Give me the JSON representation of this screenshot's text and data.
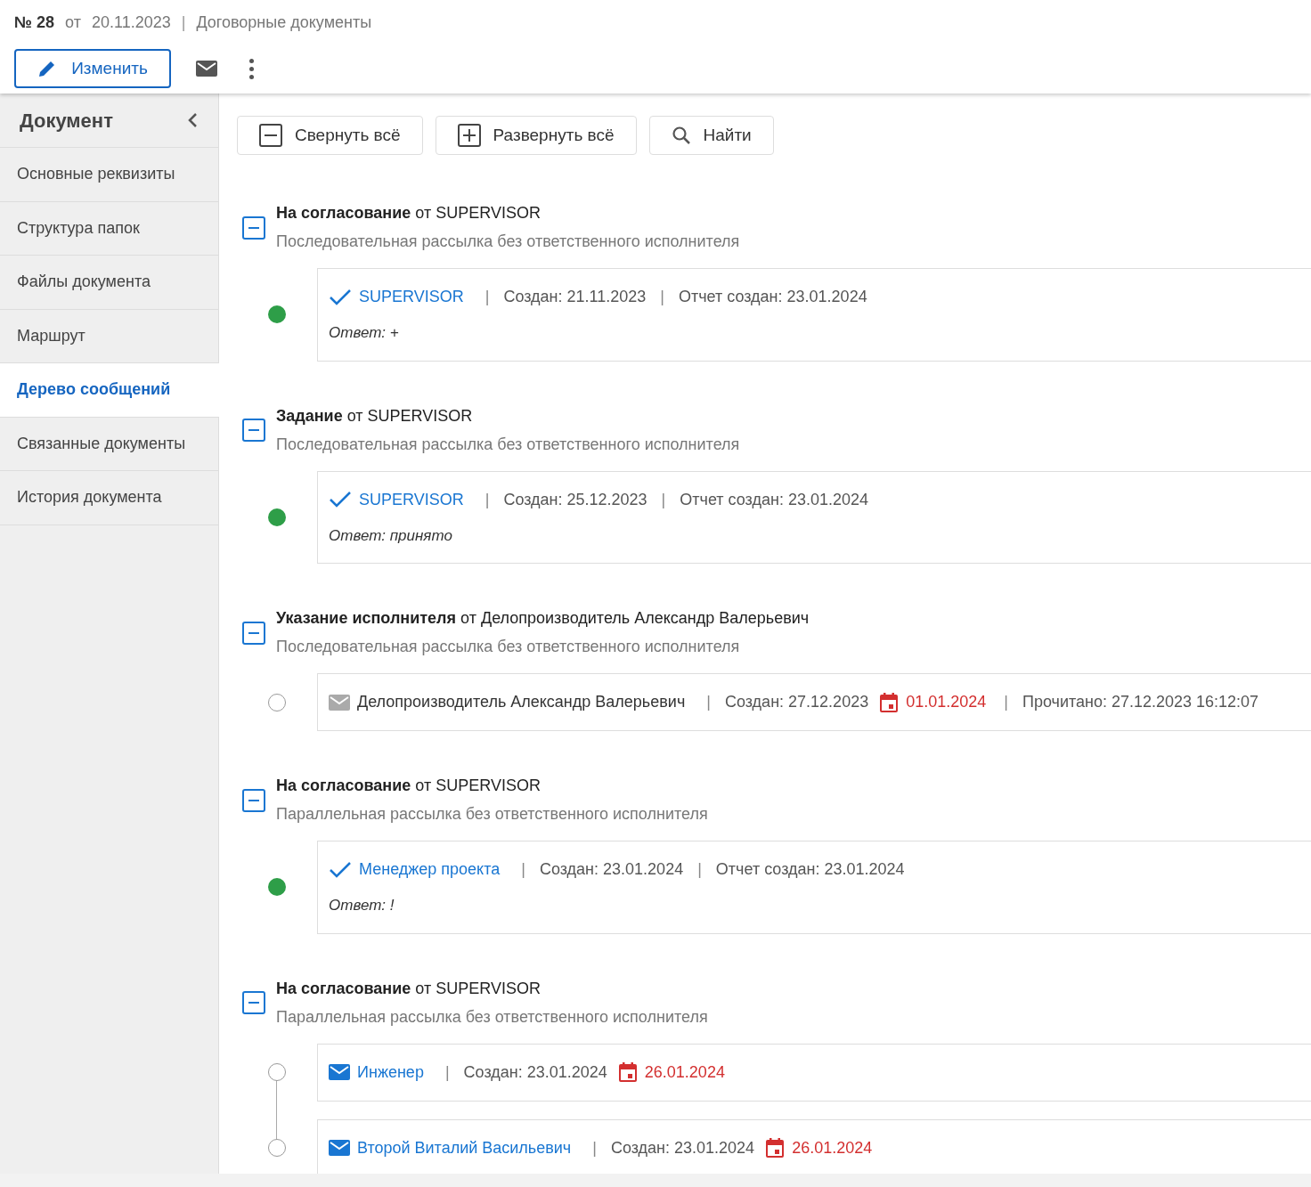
{
  "header": {
    "number": "№ 28",
    "from": "от",
    "date": "20.11.2023",
    "separator": "|",
    "category": "Договорные документы"
  },
  "actions": {
    "edit": "Изменить"
  },
  "sidebar": {
    "title": "Документ",
    "items": [
      {
        "label": "Основные реквизиты",
        "selected": false
      },
      {
        "label": "Структура папок",
        "selected": false
      },
      {
        "label": "Файлы документа",
        "selected": false
      },
      {
        "label": "Маршрут",
        "selected": false
      },
      {
        "label": "Дерево сообщений",
        "selected": true
      },
      {
        "label": "Связанные документы",
        "selected": false
      },
      {
        "label": "История документа",
        "selected": false
      }
    ]
  },
  "toolbar": [
    {
      "kind": "collapse",
      "label": "Свернуть всё"
    },
    {
      "kind": "expand",
      "label": "Развернуть всё"
    },
    {
      "kind": "search",
      "label": "Найти"
    }
  ],
  "groups": [
    {
      "type": "На согласование",
      "from": "от SUPERVISOR",
      "subtitle": "Последовательная рассылка без ответственного исполнителя",
      "expanded": true,
      "entries": [
        {
          "kind": "reported",
          "done": true,
          "name": "SUPERVISOR",
          "parts": [
            {
              "kind": "sep",
              "text": "|"
            },
            {
              "kind": "text",
              "text": "Создан: 21.11.2023"
            },
            {
              "kind": "sep",
              "text": "|"
            },
            {
              "kind": "text",
              "text": "Отчет создан: 23.01.2024"
            }
          ],
          "answer": "Ответ: +"
        }
      ]
    },
    {
      "type": "Задание",
      "from": "от SUPERVISOR",
      "subtitle": "Последовательная рассылка без ответственного исполнителя",
      "expanded": true,
      "entries": [
        {
          "kind": "reported",
          "done": true,
          "name": "SUPERVISOR",
          "parts": [
            {
              "kind": "sep",
              "text": "|"
            },
            {
              "kind": "text",
              "text": "Создан: 25.12.2023"
            },
            {
              "kind": "sep",
              "text": "|"
            },
            {
              "kind": "text",
              "text": "Отчет создан: 23.01.2024"
            }
          ],
          "answer": "Ответ: принято"
        }
      ]
    },
    {
      "type": "Указание исполнителя",
      "from": "от Делопроизводитель Александр Валерьевич",
      "subtitle": "Последовательная рассылка без ответственного исполнителя",
      "expanded": true,
      "entries": [
        {
          "kind": "read",
          "done": false,
          "name": "Делопроизводитель Александр Валерьевич",
          "parts": [
            {
              "kind": "sep",
              "text": "|"
            },
            {
              "kind": "text",
              "text": "Создан: 27.12.2023"
            },
            {
              "kind": "deadline",
              "text": "01.01.2024"
            },
            {
              "kind": "sep",
              "text": "|"
            },
            {
              "kind": "text",
              "text": "Прочитано: 27.12.2023 16:12:07"
            }
          ]
        }
      ]
    },
    {
      "type": "На согласование",
      "from": "от SUPERVISOR",
      "subtitle": "Параллельная рассылка без ответственного исполнителя",
      "expanded": true,
      "entries": [
        {
          "kind": "reported",
          "done": true,
          "name": "Менеджер проекта",
          "parts": [
            {
              "kind": "sep",
              "text": "|"
            },
            {
              "kind": "text",
              "text": "Создан: 23.01.2024"
            },
            {
              "kind": "sep",
              "text": "|"
            },
            {
              "kind": "text",
              "text": "Отчет создан: 23.01.2024"
            }
          ],
          "answer": "Ответ: !"
        }
      ]
    },
    {
      "type": "На согласование",
      "from": "от SUPERVISOR",
      "subtitle": "Параллельная рассылка без ответственного исполнителя",
      "expanded": true,
      "entries": [
        {
          "kind": "sent",
          "done": false,
          "name": "Инженер",
          "parts": [
            {
              "kind": "sep",
              "text": "|"
            },
            {
              "kind": "text",
              "text": "Создан: 23.01.2024"
            },
            {
              "kind": "deadline",
              "text": "26.01.2024"
            }
          ]
        },
        {
          "kind": "sent",
          "done": false,
          "name": "Второй Виталий Васильевич",
          "parts": [
            {
              "kind": "sep",
              "text": "|"
            },
            {
              "kind": "text",
              "text": "Создан: 23.01.2024"
            },
            {
              "kind": "deadline",
              "text": "26.01.2024"
            }
          ]
        }
      ]
    }
  ]
}
